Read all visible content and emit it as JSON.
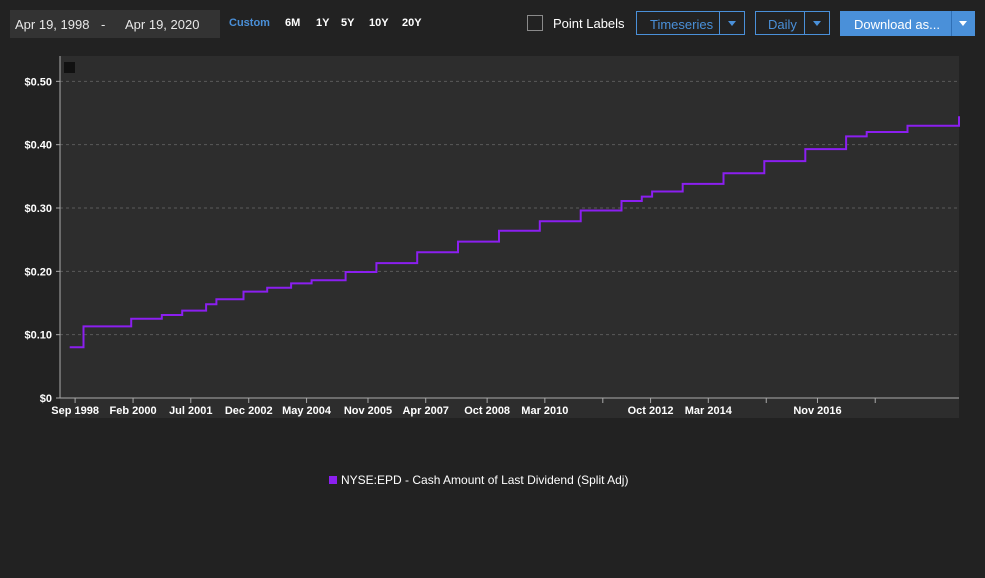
{
  "toolbar": {
    "start_date": "Apr 19, 1998",
    "separator": "-",
    "end_date": "Apr 19, 2020",
    "ranges": [
      {
        "label": "Custom",
        "active": true
      },
      {
        "label": "6M",
        "active": false
      },
      {
        "label": "1Y",
        "active": false
      },
      {
        "label": "5Y",
        "active": false
      },
      {
        "label": "10Y",
        "active": false
      },
      {
        "label": "20Y",
        "active": false
      }
    ],
    "point_labels": "Point Labels",
    "view_select": "Timeseries",
    "freq_select": "Daily",
    "download": "Download as..."
  },
  "colors": {
    "accent": "#4a90d9",
    "series": "#8b1ff0",
    "plot_bg": "#2d2d2d",
    "page_bg": "#222222"
  },
  "chart_data": {
    "type": "line",
    "title": "",
    "xlabel": "",
    "ylabel": "",
    "ylim": [
      0,
      0.54
    ],
    "yticks": [
      0,
      0.1,
      0.2,
      0.3,
      0.4,
      0.5
    ],
    "ytick_labels": [
      "$0",
      "$0.10",
      "$0.20",
      "$0.30",
      "$0.40",
      "$0.50"
    ],
    "xlim": [
      "1998-04-19",
      "2020-04-19"
    ],
    "xticks": [
      {
        "date": "1998-09-01",
        "label": "Sep 1998"
      },
      {
        "date": "2000-02-01",
        "label": "Feb 2000"
      },
      {
        "date": "2001-07-01",
        "label": "Jul 2001"
      },
      {
        "date": "2002-12-01",
        "label": "Dec 2002"
      },
      {
        "date": "2004-05-01",
        "label": "May 2004"
      },
      {
        "date": "2005-11-01",
        "label": "Nov 2005"
      },
      {
        "date": "2007-04-01",
        "label": "Apr 2007"
      },
      {
        "date": "2008-10-01",
        "label": "Oct 2008"
      },
      {
        "date": "2010-03-01",
        "label": "Mar 2010"
      },
      {
        "date": "2011-08-01",
        "label": ""
      },
      {
        "date": "2012-10-01",
        "label": "Oct 2012"
      },
      {
        "date": "2014-03-01",
        "label": "Mar 2014"
      },
      {
        "date": "2015-08-01",
        "label": ""
      },
      {
        "date": "2016-11-01",
        "label": "Nov 2016"
      },
      {
        "date": "2018-04-01",
        "label": ""
      }
    ],
    "grid": true,
    "legend_position": "bottom-center",
    "series": [
      {
        "name": "NYSE:EPD - Cash Amount of Last Dividend (Split Adj)",
        "color": "#8b1ff0",
        "step": true,
        "points": [
          [
            "1998-07-15",
            0.08
          ],
          [
            "1998-11-15",
            0.113
          ],
          [
            "2000-01-15",
            0.125
          ],
          [
            "2000-10-15",
            0.131
          ],
          [
            "2001-01-15",
            0.131
          ],
          [
            "2001-04-15",
            0.138
          ],
          [
            "2001-11-15",
            0.148
          ],
          [
            "2002-02-15",
            0.156
          ],
          [
            "2002-10-15",
            0.168
          ],
          [
            "2003-05-15",
            0.174
          ],
          [
            "2003-12-15",
            0.181
          ],
          [
            "2004-06-15",
            0.186
          ],
          [
            "2005-01-15",
            0.186
          ],
          [
            "2005-04-15",
            0.199
          ],
          [
            "2006-01-15",
            0.213
          ],
          [
            "2007-01-15",
            0.23
          ],
          [
            "2008-01-15",
            0.247
          ],
          [
            "2009-01-15",
            0.264
          ],
          [
            "2010-01-15",
            0.279
          ],
          [
            "2011-01-15",
            0.296
          ],
          [
            "2012-01-15",
            0.311
          ],
          [
            "2012-07-15",
            0.318
          ],
          [
            "2012-10-15",
            0.326
          ],
          [
            "2013-07-15",
            0.338
          ],
          [
            "2014-07-15",
            0.355
          ],
          [
            "2015-07-15",
            0.374
          ],
          [
            "2016-07-15",
            0.393
          ],
          [
            "2017-07-15",
            0.413
          ],
          [
            "2018-01-15",
            0.42
          ],
          [
            "2019-01-15",
            0.43
          ],
          [
            "2020-04-19",
            0.445
          ]
        ]
      }
    ]
  }
}
